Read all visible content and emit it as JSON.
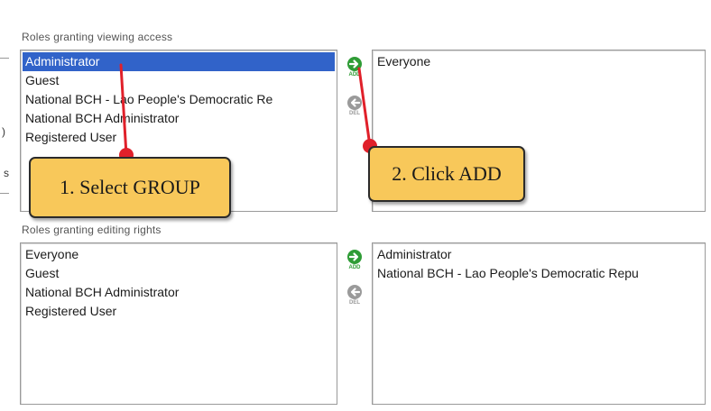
{
  "viewing": {
    "label": "Roles granting viewing access",
    "available": [
      "Administrator",
      "Guest",
      "National BCH - Lao People's Democratic Re",
      "National BCH Administrator",
      "Registered User"
    ],
    "selected_index": 0,
    "assigned": [
      "Everyone"
    ]
  },
  "editing": {
    "label": "Roles granting editing rights",
    "available": [
      "Everyone",
      "Guest",
      "National BCH Administrator",
      "Registered User"
    ],
    "assigned": [
      "Administrator",
      "National BCH - Lao People's Democratic Repu"
    ]
  },
  "buttons": {
    "add_text": "ADD",
    "del_text": "DEL"
  },
  "edge_marks": {
    "paren": ")",
    "s": "s"
  },
  "annotations": {
    "step1": "1. Select GROUP",
    "step2": "2. Click ADD"
  },
  "colors": {
    "selection": "#3163c9",
    "add_icon": "#2f9c36",
    "del_icon": "#9a9a9a",
    "callout_fill": "#f8c85a",
    "pointer": "#e0202a"
  },
  "icons": {
    "add": "right-arrow-circle-icon",
    "del": "left-arrow-circle-icon"
  }
}
